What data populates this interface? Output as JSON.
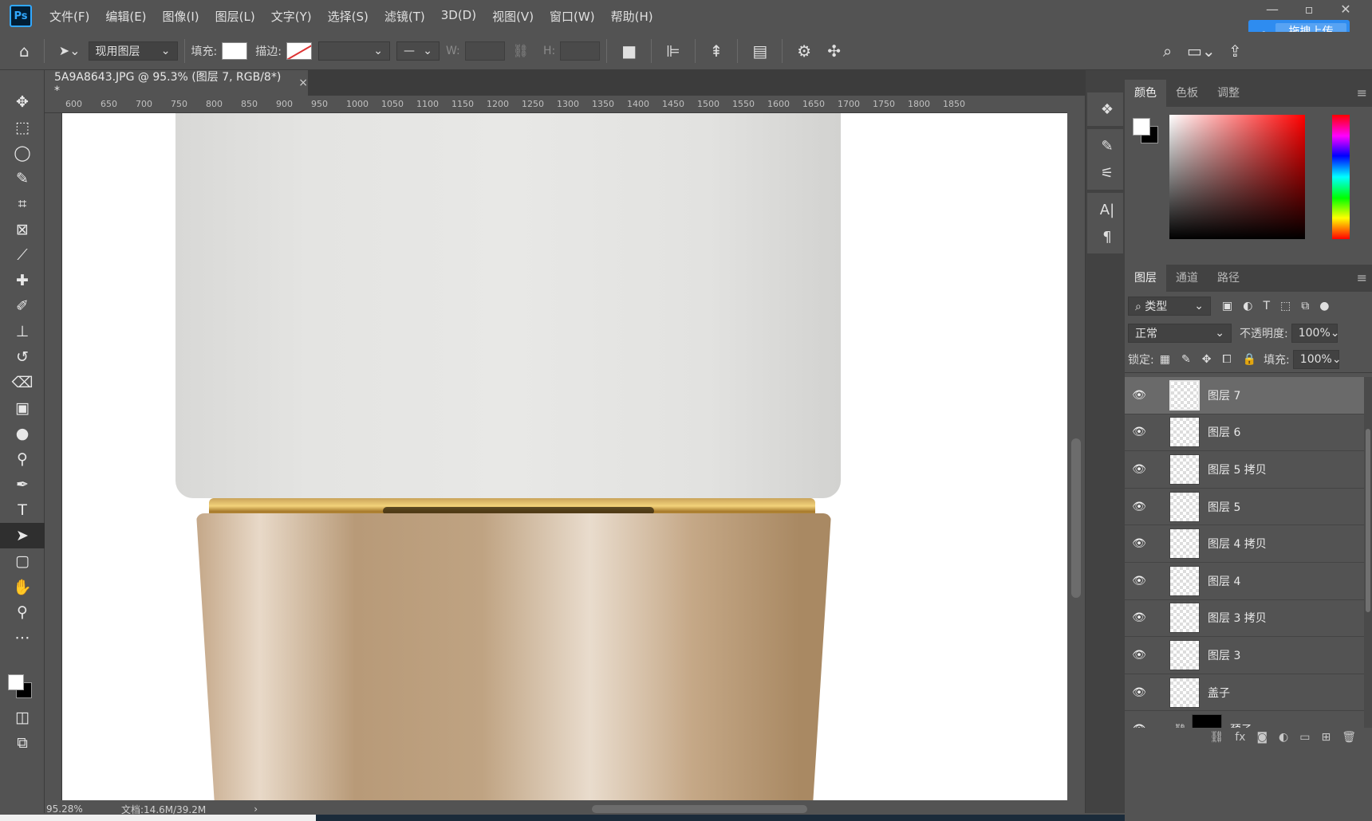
{
  "app": {
    "logo": "Ps",
    "menu": [
      "文件(F)",
      "编辑(E)",
      "图像(I)",
      "图层(L)",
      "文字(Y)",
      "选择(S)",
      "滤镜(T)",
      "3D(D)",
      "视图(V)",
      "窗口(W)",
      "帮助(H)"
    ],
    "upload_button": "拖拽上传"
  },
  "options_bar": {
    "layer_select": "现用图层",
    "fill_label": "填充:",
    "stroke_label": "描边:",
    "w_label": "W:",
    "h_label": "H:"
  },
  "document": {
    "tab_title": "5A9A8643.JPG @ 95.3% (图层 7, RGB/8*) *",
    "close_symbol": "×"
  },
  "ruler": {
    "top_ticks": [
      "600",
      "650",
      "700",
      "750",
      "800",
      "850",
      "900",
      "950",
      "1000",
      "1050",
      "1100",
      "1150",
      "1200",
      "1250",
      "1300",
      "1350",
      "1400",
      "1450",
      "1500",
      "1550",
      "1600",
      "1650",
      "1700",
      "1750",
      "1800",
      "1850"
    ]
  },
  "status": {
    "zoom": "95.28%",
    "doc_info": "文档:14.6M/39.2M"
  },
  "color_panel": {
    "tabs": [
      "颜色",
      "色板",
      "调整"
    ],
    "active_tab": "颜色",
    "foreground": "#ffffff",
    "background": "#000000"
  },
  "layers_panel": {
    "tabs": [
      "图层",
      "通道",
      "路径"
    ],
    "active_tab": "图层",
    "filter_label": "类型",
    "blend_mode": "正常",
    "opacity_label": "不透明度:",
    "opacity_value": "100%",
    "lock_label": "锁定:",
    "fill_label": "填充:",
    "fill_value": "100%",
    "layers": [
      {
        "name": "图层 7",
        "selected": true
      },
      {
        "name": "图层 6",
        "selected": false
      },
      {
        "name": "图层 5 拷贝",
        "selected": false
      },
      {
        "name": "图层 5",
        "selected": false
      },
      {
        "name": "图层 4 拷贝",
        "selected": false
      },
      {
        "name": "图层 4",
        "selected": false
      },
      {
        "name": "图层 3 拷贝",
        "selected": false
      },
      {
        "name": "图层 3",
        "selected": false
      },
      {
        "name": "盖子",
        "selected": false
      },
      {
        "name": "颈子",
        "selected": false,
        "group": true
      }
    ]
  }
}
